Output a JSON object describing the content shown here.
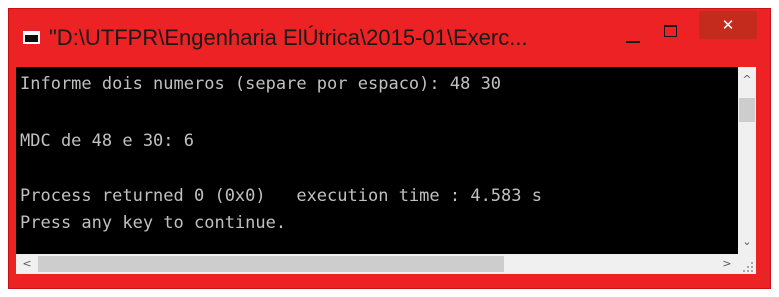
{
  "window": {
    "title": "\"D:\\UTFPR\\Engenharia ElÚtrica\\2015-01\\Exerc...",
    "icon": "console-window-icon",
    "controls": {
      "minimize_icon": "minimize-icon",
      "maximize_icon": "maximize-icon",
      "close_label": "✕"
    },
    "accent_color": "#ed2224"
  },
  "console": {
    "background": "#000000",
    "text_color": "#c0c0c0",
    "lines": [
      "Informe dois numeros (separe por espaco): 48 30",
      "",
      "MDC de 48 e 30: 6",
      "",
      "Process returned 0 (0x0)   execution time : 4.583 s",
      "Press any key to continue."
    ]
  },
  "scrollbars": {
    "vertical": {
      "up_arrow": "^",
      "down_arrow": "⌄"
    },
    "horizontal": {
      "left_arrow": "<",
      "right_arrow": ">"
    }
  }
}
